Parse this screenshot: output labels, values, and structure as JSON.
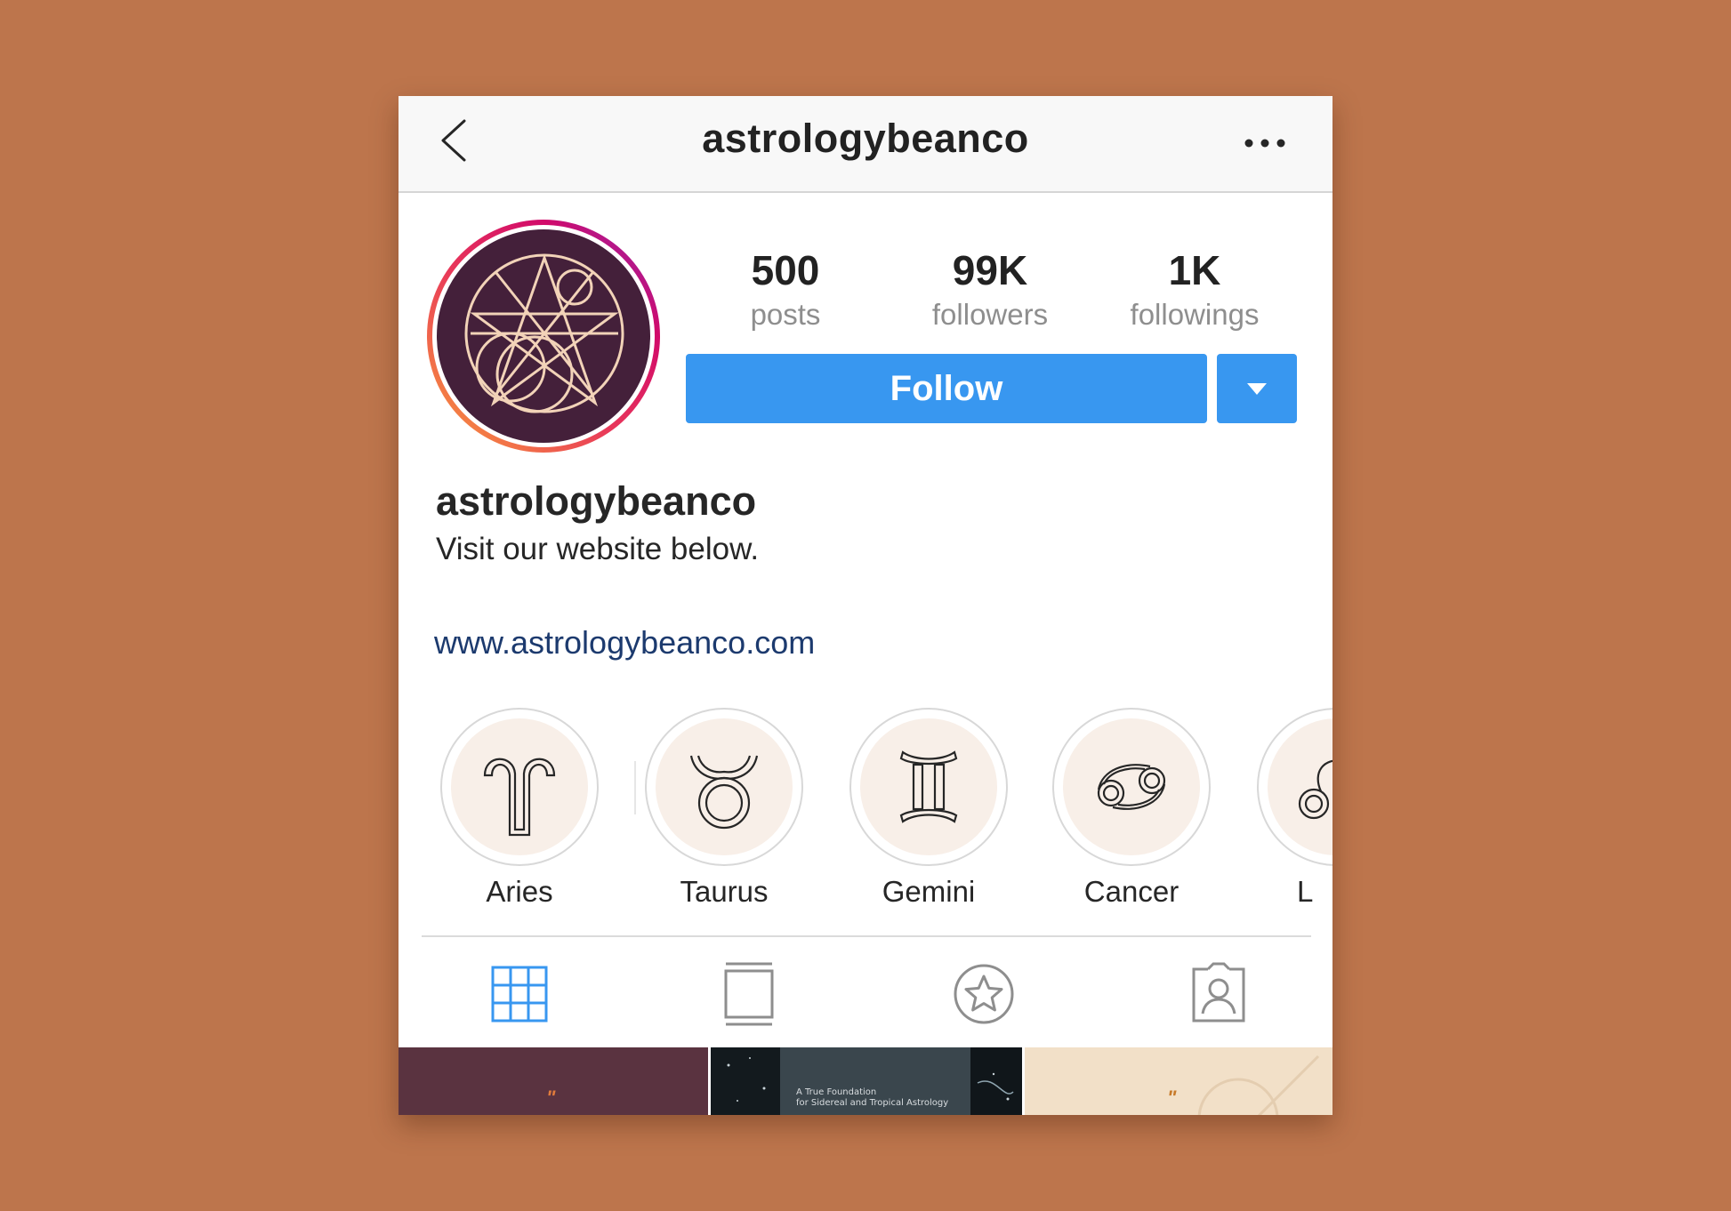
{
  "header": {
    "title": "astrologybeanco"
  },
  "stats": [
    {
      "value": "500",
      "label": "posts"
    },
    {
      "value": "99K",
      "label": "followers"
    },
    {
      "value": "1K",
      "label": "followings"
    }
  ],
  "actions": {
    "follow_label": "Follow"
  },
  "profile": {
    "username": "astrologybeanco",
    "bio": "Visit our website below.",
    "website": "www.astrologybeanco.com"
  },
  "highlights": [
    {
      "label": "Aries",
      "icon": "aries-icon"
    },
    {
      "label": "Taurus",
      "icon": "taurus-icon"
    },
    {
      "label": "Gemini",
      "icon": "gemini-icon"
    },
    {
      "label": "Cancer",
      "icon": "cancer-icon"
    },
    {
      "label": "L",
      "icon": "leo-icon"
    }
  ],
  "tabs": [
    {
      "icon": "grid-icon",
      "active": true
    },
    {
      "icon": "feed-icon",
      "active": false
    },
    {
      "icon": "star-icon",
      "active": false
    },
    {
      "icon": "tagged-icon",
      "active": false
    }
  ],
  "posts": [
    {
      "quote": "\""
    },
    {
      "caption_line1": "A True Foundation",
      "caption_line2": "for Sidereal and Tropical Astrology"
    },
    {
      "quote": "\""
    }
  ],
  "colors": {
    "background": "#bd754c",
    "follow_button": "#3897f0",
    "link": "#1c3a6e",
    "active_tab": "#3897f0",
    "avatar_fill": "#44203a",
    "avatar_line": "#f2d3b8"
  }
}
